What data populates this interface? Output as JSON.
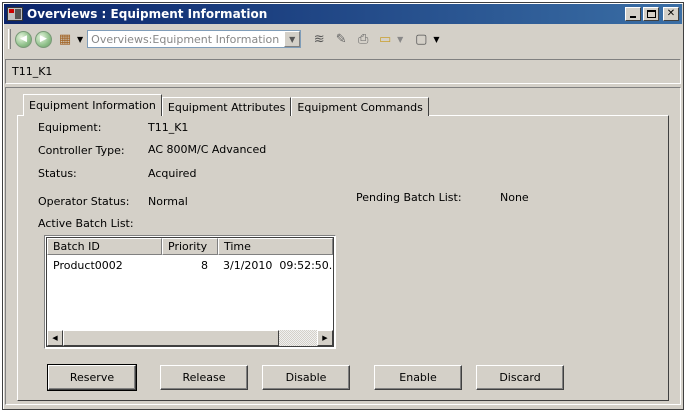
{
  "window": {
    "title": "Overviews : Equipment Information"
  },
  "toolbar": {
    "back_icon": "back-arrow-icon",
    "forward_icon": "forward-arrow-icon",
    "address_value": "Overviews:Equipment Information"
  },
  "object_path": "T11_K1",
  "tabs": [
    {
      "label": "Equipment Information",
      "active": true
    },
    {
      "label": "Equipment Attributes",
      "active": false
    },
    {
      "label": "Equipment Commands",
      "active": false
    }
  ],
  "info": {
    "equipment_label": "Equipment:",
    "equipment_value": "T11_K1",
    "controller_label": "Controller Type:",
    "controller_value": "AC 800M/C Advanced",
    "status_label": "Status:",
    "status_value": "Acquired",
    "operator_label": "Operator Status:",
    "operator_value": "Normal",
    "pending_label": "Pending Batch List:",
    "pending_value": "None",
    "active_label": "Active Batch List:"
  },
  "batch_table": {
    "columns": [
      "Batch ID",
      "Priority",
      "Time"
    ],
    "rows": [
      {
        "batch_id": "Product0002",
        "priority": "8",
        "time": "3/1/2010  09:52:50."
      }
    ]
  },
  "buttons": {
    "reserve": "Reserve",
    "release": "Release",
    "disable": "Disable",
    "enable": "Enable",
    "discard": "Discard"
  }
}
